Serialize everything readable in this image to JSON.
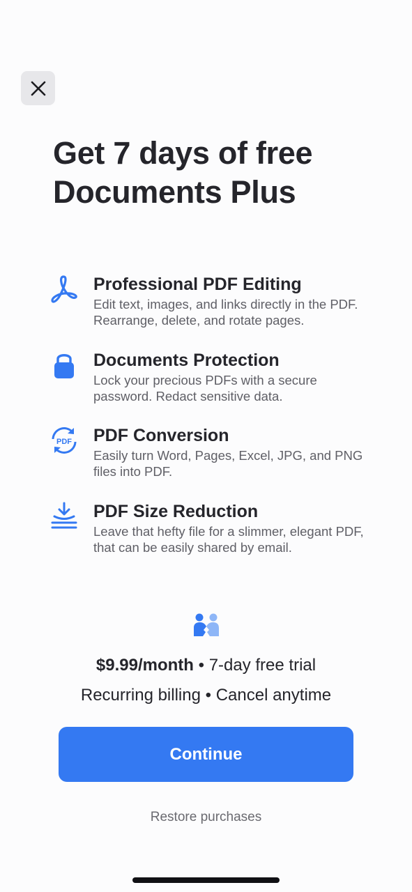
{
  "header": {
    "close_icon": "close-icon",
    "title": "Get 7 days of free Documents Plus"
  },
  "features": [
    {
      "icon": "pdf-acrobat-icon",
      "title": "Professional PDF Editing",
      "description": "Edit text, images, and links directly in the PDF. Rearrange, delete, and rotate pages."
    },
    {
      "icon": "lock-icon",
      "title": "Documents Protection",
      "description": "Lock your precious PDFs with a secure password. Redact sensitive data."
    },
    {
      "icon": "pdf-conversion-icon",
      "icon_label": "PDF",
      "title": "PDF Conversion",
      "description": "Easily turn Word, Pages, Excel, JPG, and PNG files into PDF."
    },
    {
      "icon": "size-reduction-icon",
      "title": "PDF Size Reduction",
      "description": "Leave that hefty file for a slimmer, elegant PDF, that can be easily shared by email."
    }
  ],
  "family_icon": "people-handshake-icon",
  "pricing": {
    "price": "$9.99/month",
    "separator": "•",
    "trial": "7-day free trial",
    "billing": "Recurring billing",
    "cancel": "Cancel anytime"
  },
  "actions": {
    "continue_label": "Continue",
    "restore_label": "Restore purchases"
  },
  "colors": {
    "accent": "#3479f2",
    "background": "#fcfcfd",
    "text_primary": "#25252b",
    "text_secondary": "#5f5f66"
  }
}
